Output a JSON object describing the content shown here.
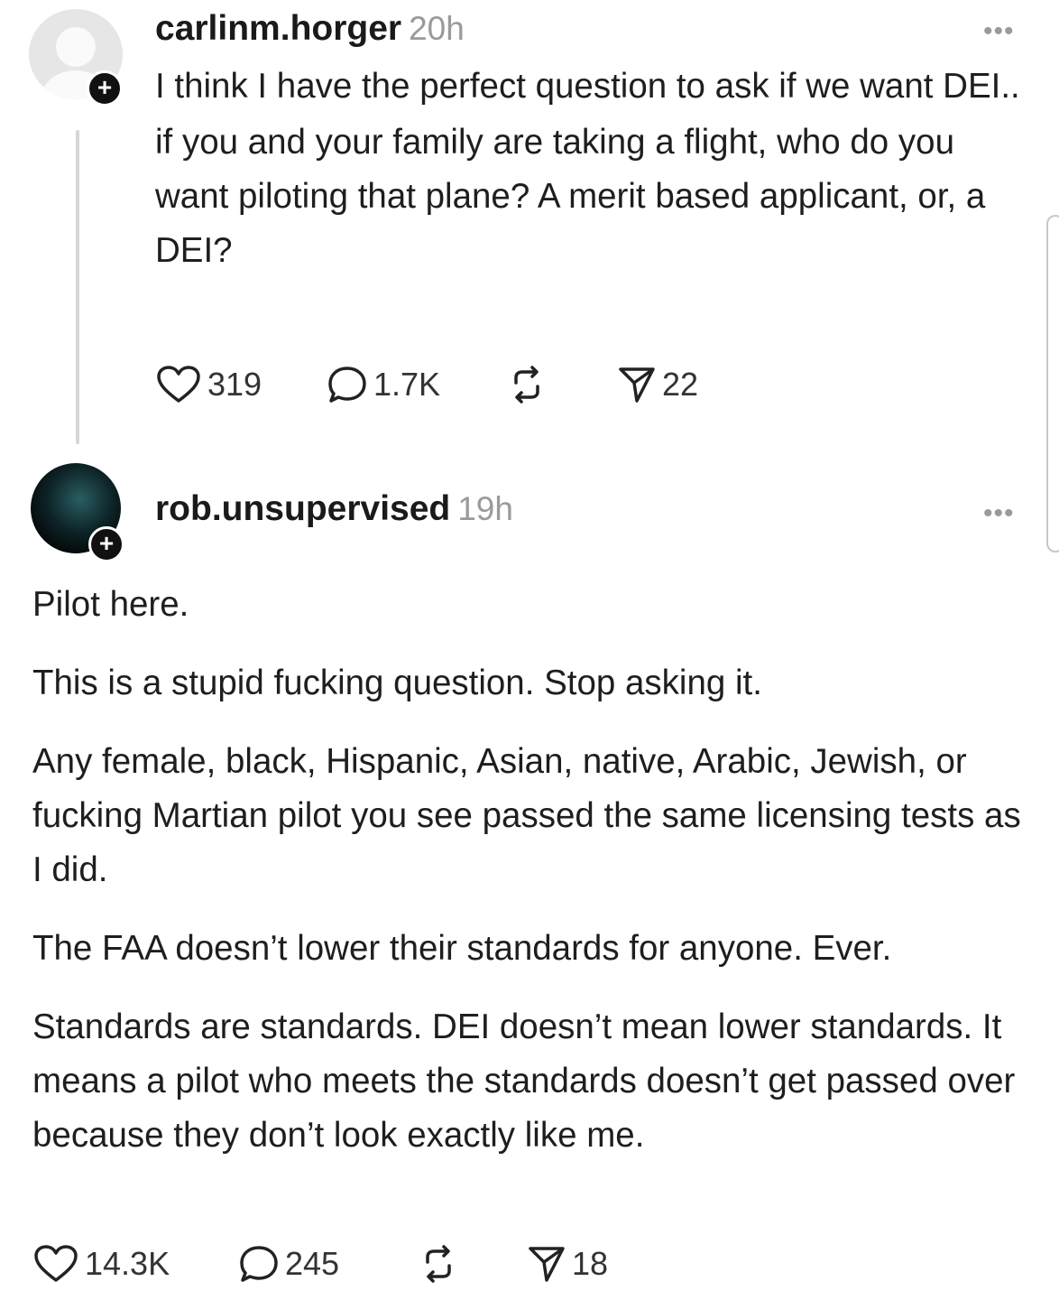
{
  "post": {
    "username": "carlinm.horger",
    "time": "20h",
    "paragraphs": [
      "I think I have the perfect question to ask if we want DEI..",
      "if you and your family are taking a flight, who do you want piloting that plane? A merit based applicant, or, a DEI?"
    ],
    "likes": "319",
    "comments": "1.7K",
    "shares": "22"
  },
  "reply": {
    "username": "rob.unsupervised",
    "time": "19h",
    "paragraphs": [
      "Pilot here.",
      "This is a stupid fucking question.  Stop asking it.",
      "Any female, black, Hispanic, Asian, native, Arabic, Jewish, or fucking Martian pilot you see passed the same licensing tests as I did.",
      "The FAA doesn’t lower their standards for anyone.  Ever.",
      "Standards are standards.  DEI doesn’t mean lower standards.  It means a pilot who meets the standards doesn’t get passed over because they don’t look exactly like me."
    ],
    "likes": "14.3K",
    "comments": "245",
    "shares": "18"
  },
  "ui": {
    "more_label": "•••",
    "follow_label": "+"
  },
  "icons": [
    "heart-icon",
    "comment-icon",
    "repost-icon",
    "share-icon",
    "more-icon",
    "avatar-icon"
  ]
}
